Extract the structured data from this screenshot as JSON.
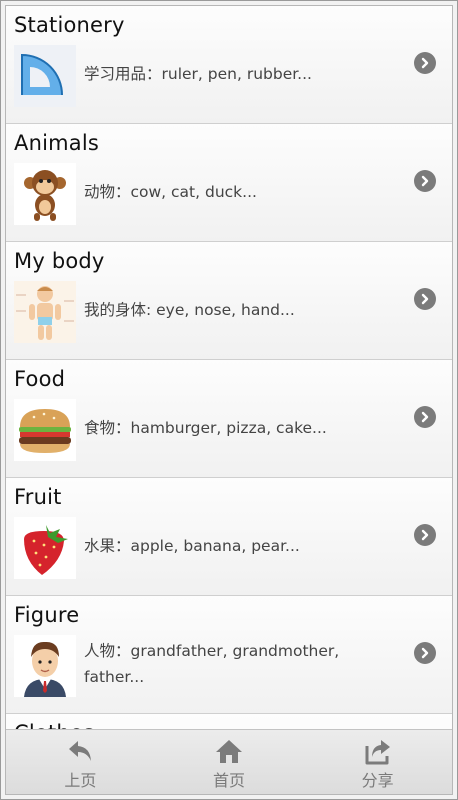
{
  "categories": [
    {
      "title": "Stationery",
      "desc": "学习用品：ruler, pen, rubber...",
      "icon": "protractor-icon"
    },
    {
      "title": "Animals",
      "desc": "动物：cow, cat, duck...",
      "icon": "monkey-icon"
    },
    {
      "title": "My body",
      "desc": "我的身体: eye, nose, hand...",
      "icon": "body-icon"
    },
    {
      "title": "Food",
      "desc": "食物：hamburger, pizza, cake...",
      "icon": "hamburger-icon"
    },
    {
      "title": "Fruit",
      "desc": "水果：apple, banana, pear...",
      "icon": "strawberry-icon"
    },
    {
      "title": "Figure",
      "desc": "人物：grandfather, grandmother, father...",
      "icon": "person-icon"
    },
    {
      "title": "Clothes",
      "desc": "",
      "icon": ""
    }
  ],
  "tabbar": {
    "back_label": "上页",
    "home_label": "首页",
    "share_label": "分享"
  },
  "colors": {
    "icon_gray": "#7b7b7b",
    "tab_label": "#7a7a7a"
  }
}
